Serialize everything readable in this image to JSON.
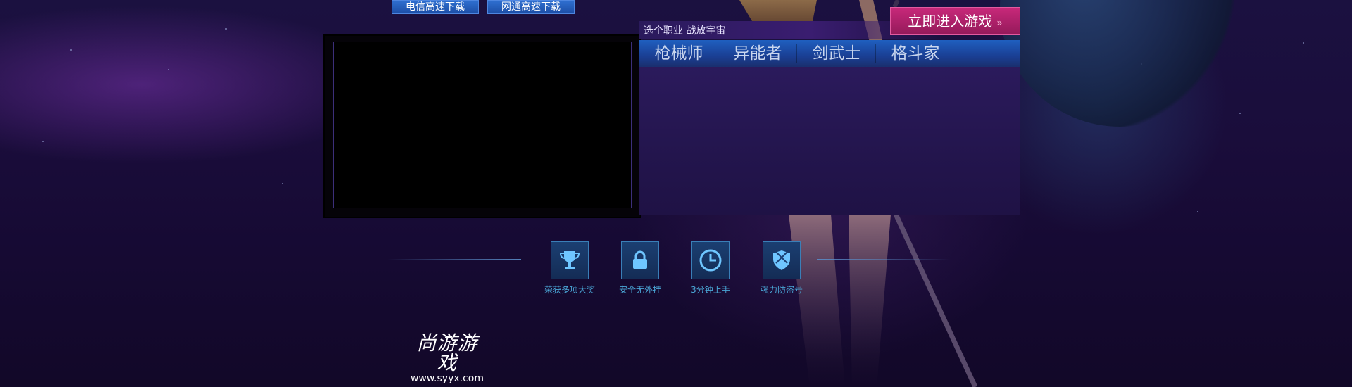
{
  "downloads": {
    "telecom_label": "电信高速下载",
    "netcom_label": "网通高速下载"
  },
  "career_panel": {
    "slogan": "选个职业  战放宇宙",
    "enter_button": "立即进入游戏",
    "enter_chevron": "»",
    "tabs": [
      "枪械师",
      "异能者",
      "剑武士",
      "格斗家"
    ]
  },
  "features": [
    {
      "label": "荣获多项大奖",
      "icon": "trophy-icon"
    },
    {
      "label": "安全无外挂",
      "icon": "lock-icon"
    },
    {
      "label": "3分钟上手",
      "icon": "clock-icon"
    },
    {
      "label": "强力防盗号",
      "icon": "shield-icon"
    }
  ],
  "logo": {
    "name": "尚游游戏",
    "url": "www.syyx.com"
  },
  "colors": {
    "background": "#1a0d3b",
    "tab_bar": "#1f5fbf",
    "enter_button": "#c8287a",
    "feature_label": "#4aa6d6"
  }
}
